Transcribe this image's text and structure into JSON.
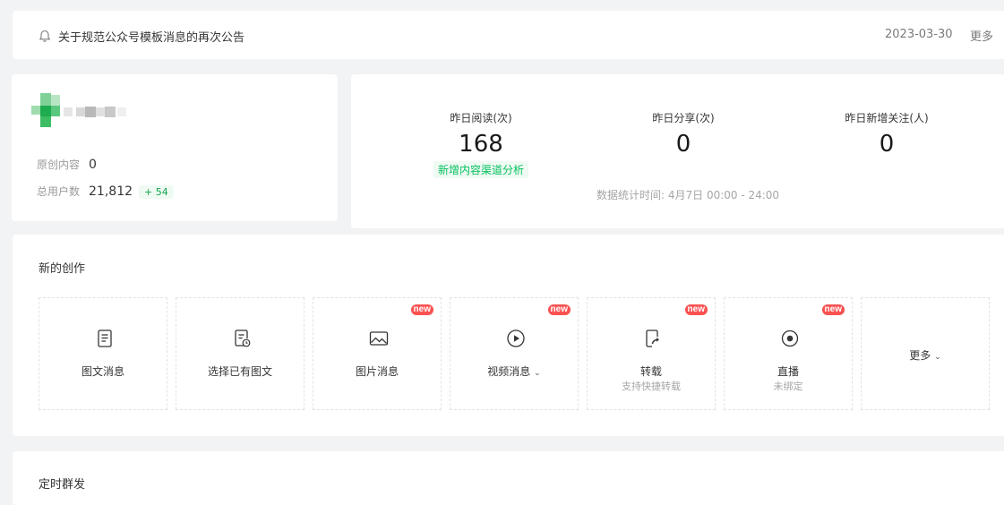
{
  "notice": {
    "icon": "bell-icon",
    "text": "关于规范公众号模板消息的再次公告",
    "date": "2023-03-30",
    "more": "更多"
  },
  "account": {
    "original_label": "原创内容",
    "original_value": "0",
    "users_label": "总用户数",
    "users_value": "21,812",
    "users_growth": "+ 54"
  },
  "stats": {
    "read": {
      "label": "昨日阅读(次)",
      "value": "168",
      "link": "新增内容渠道分析"
    },
    "share": {
      "label": "昨日分享(次)",
      "value": "0"
    },
    "follow": {
      "label": "昨日新增关注(人)",
      "value": "0"
    },
    "time_info": "数据统计时间: 4月7日 00:00 - 24:00"
  },
  "create": {
    "title": "新的创作",
    "items": [
      {
        "label": "图文消息",
        "icon": "document-icon"
      },
      {
        "label": "选择已有图文",
        "icon": "document-clock-icon"
      },
      {
        "label": "图片消息",
        "icon": "image-icon",
        "badge": "new"
      },
      {
        "label": "视频消息",
        "icon": "play-circle-icon",
        "badge": "new"
      },
      {
        "label": "转载",
        "icon": "share-arrow-icon",
        "badge": "new",
        "sub": "支持快捷转载"
      },
      {
        "label": "直播",
        "icon": "live-record-icon",
        "badge": "new",
        "sub": "未绑定"
      },
      {
        "label": "更多",
        "icon": "chevron-down-icon"
      }
    ]
  },
  "timer": {
    "title": "定时群发"
  },
  "colors": {
    "accent": "#07c160",
    "badge": "#fa5151",
    "background": "#f2f3f5"
  }
}
